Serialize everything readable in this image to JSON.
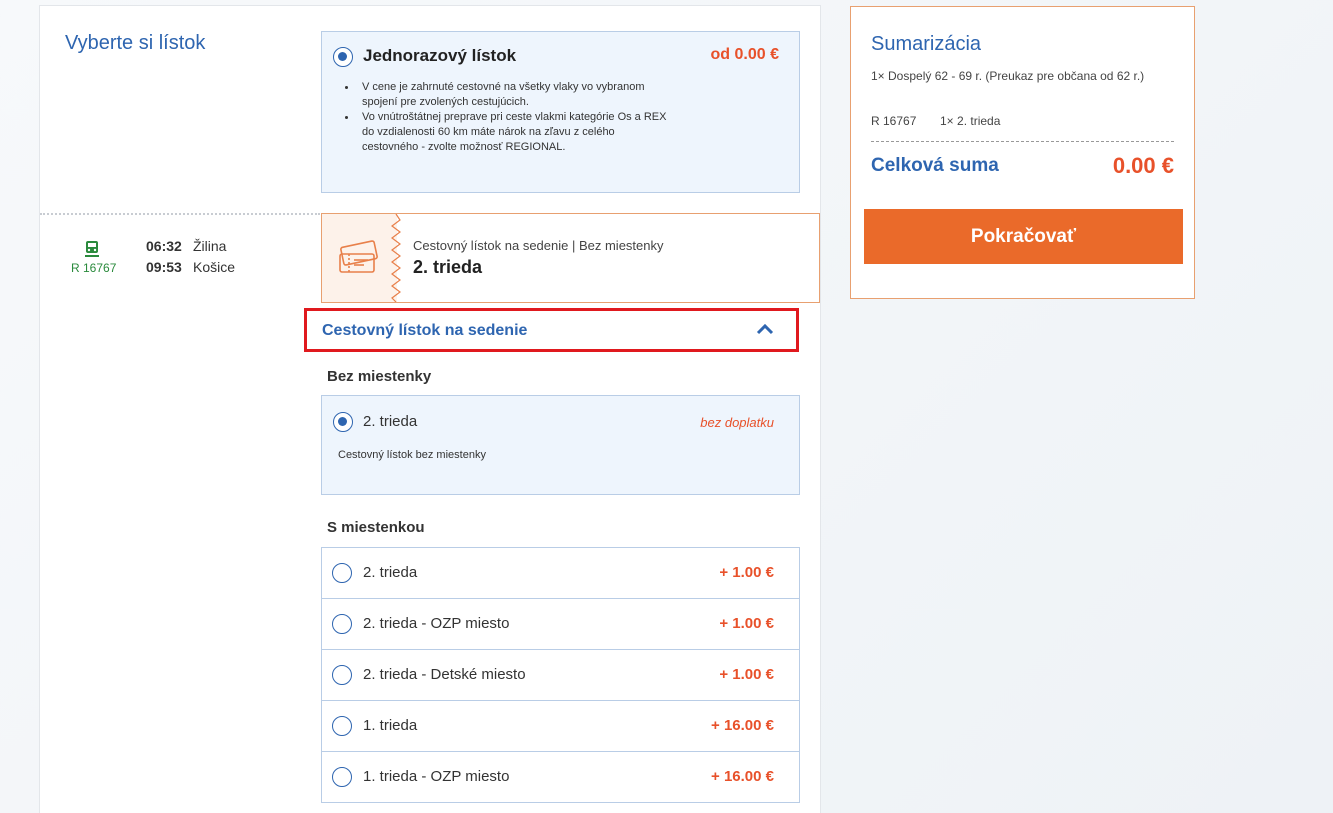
{
  "page": {
    "title": "Vyberte si lístok"
  },
  "ticket": {
    "name": "Jednorazový lístok",
    "price": "od 0.00 €",
    "bullets": [
      "V cene je zahrnuté cestovné na všetky vlaky vo vybranom spojení pre zvolených cestujúcich.",
      "Vo vnútroštátnej preprave pri ceste vlakmi kategórie Os a REX do vzdialenosti 60 km máte nárok na zľavu z celého cestovného - zvolte možnosť REGIONAL."
    ]
  },
  "connection": {
    "train_number": "R 16767",
    "departure_time": "06:32",
    "departure_station": "Žilina",
    "arrival_time": "09:53",
    "arrival_station": "Košice"
  },
  "class_card": {
    "subtitle": "Cestovný lístok na sedenie | Bez miestenky",
    "class": "2. trieda"
  },
  "accordion": {
    "title": "Cestovný lístok na sedenie"
  },
  "no_reservation": {
    "group_label": "Bez miestenky",
    "option_label": "2. trieda",
    "extra": "bez doplatku",
    "description": "Cestovný lístok bez miestenky"
  },
  "with_reservation": {
    "group_label": "S miestenkou",
    "options": [
      {
        "label": "2. trieda",
        "price": "+ 1.00 €"
      },
      {
        "label": "2. trieda - OZP miesto",
        "price": "+ 1.00 €"
      },
      {
        "label": "2. trieda - Detské miesto",
        "price": "+ 1.00 €"
      },
      {
        "label": "1. trieda",
        "price": "+ 16.00 €"
      },
      {
        "label": "1. trieda - OZP miesto",
        "price": "+ 16.00 €"
      }
    ]
  },
  "summary": {
    "title": "Sumarizácia",
    "passenger": "1× Dospelý 62 - 69 r. (Preukaz pre občana od 62 r.)",
    "train": "R 16767",
    "class": "1× 2. trieda",
    "total_label": "Celková suma",
    "total_value": "0.00 €",
    "continue_label": "Pokračovať"
  },
  "colors": {
    "brand_blue": "#2e65b0",
    "accent_orange": "#ea6a2a",
    "price_red": "#e8512a",
    "highlight_red": "#e0191e",
    "train_green": "#2a8a3c"
  }
}
